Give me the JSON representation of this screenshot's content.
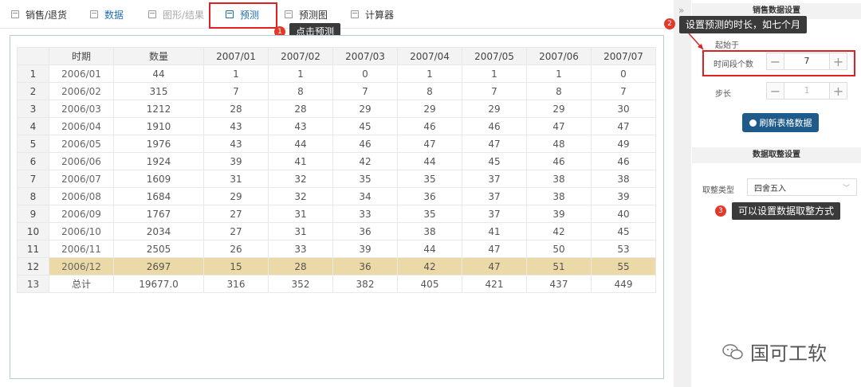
{
  "tabs": [
    {
      "label": "销售/退货"
    },
    {
      "label": "数据"
    },
    {
      "label": "图形/结果"
    },
    {
      "label": "预测"
    },
    {
      "label": "预测图"
    },
    {
      "label": "计算器"
    }
  ],
  "annotations": {
    "tip1": {
      "num": "1",
      "text": "点击预测"
    },
    "tip2": {
      "num": "2",
      "text": "设置预测的时长，如七个月"
    },
    "tip3": {
      "num": "3",
      "text": "可以设置数据取整方式"
    }
  },
  "table": {
    "headers": [
      "",
      "时期",
      "数量",
      "2007/01",
      "2007/02",
      "2007/03",
      "2007/04",
      "2007/05",
      "2007/06",
      "2007/07"
    ],
    "rows": [
      [
        "1",
        "2006/01",
        "44",
        "1",
        "1",
        "0",
        "1",
        "1",
        "1",
        "0"
      ],
      [
        "2",
        "2006/02",
        "315",
        "7",
        "8",
        "7",
        "8",
        "7",
        "8",
        "7"
      ],
      [
        "3",
        "2006/03",
        "1212",
        "28",
        "28",
        "29",
        "29",
        "29",
        "29",
        "30"
      ],
      [
        "4",
        "2006/04",
        "1910",
        "43",
        "43",
        "45",
        "46",
        "46",
        "47",
        "47"
      ],
      [
        "5",
        "2006/05",
        "1976",
        "43",
        "44",
        "46",
        "47",
        "47",
        "48",
        "49"
      ],
      [
        "6",
        "2006/06",
        "1924",
        "39",
        "41",
        "42",
        "44",
        "45",
        "46",
        "46"
      ],
      [
        "7",
        "2006/07",
        "1609",
        "31",
        "32",
        "35",
        "35",
        "37",
        "38",
        "38"
      ],
      [
        "8",
        "2006/08",
        "1684",
        "29",
        "32",
        "34",
        "36",
        "37",
        "38",
        "39"
      ],
      [
        "9",
        "2006/09",
        "1767",
        "27",
        "31",
        "33",
        "35",
        "37",
        "39",
        "40"
      ],
      [
        "10",
        "2006/10",
        "2034",
        "27",
        "31",
        "36",
        "38",
        "41",
        "42",
        "45"
      ],
      [
        "11",
        "2006/11",
        "2505",
        "26",
        "33",
        "39",
        "44",
        "47",
        "50",
        "53"
      ],
      [
        "12",
        "2006/12",
        "2697",
        "15",
        "28",
        "36",
        "42",
        "47",
        "51",
        "55"
      ],
      [
        "13",
        "总计",
        "19677.0",
        "316",
        "352",
        "382",
        "405",
        "421",
        "437",
        "449"
      ]
    ],
    "highlight_row": 12,
    "highlight_color": "#ecd9a8"
  },
  "sidebar": {
    "collapse_glyph": "»",
    "sales_section_title": "销售数据设置",
    "start_label": "起始于",
    "periods_label": "时间段个数",
    "periods_value": "7",
    "step_label": "步长",
    "step_value": "1",
    "refresh_button": "刷新表格数据",
    "rounding_section_title": "数据取整设置",
    "rounding_type_label": "取整类型",
    "rounding_type_value": "四舍五入"
  },
  "watermark": {
    "text": "国可工软"
  },
  "colors": {
    "accent": "#1f6fb5",
    "button": "#1f5b8a",
    "annotation_red": "#e02020",
    "highlight": "#ecd9a8"
  }
}
